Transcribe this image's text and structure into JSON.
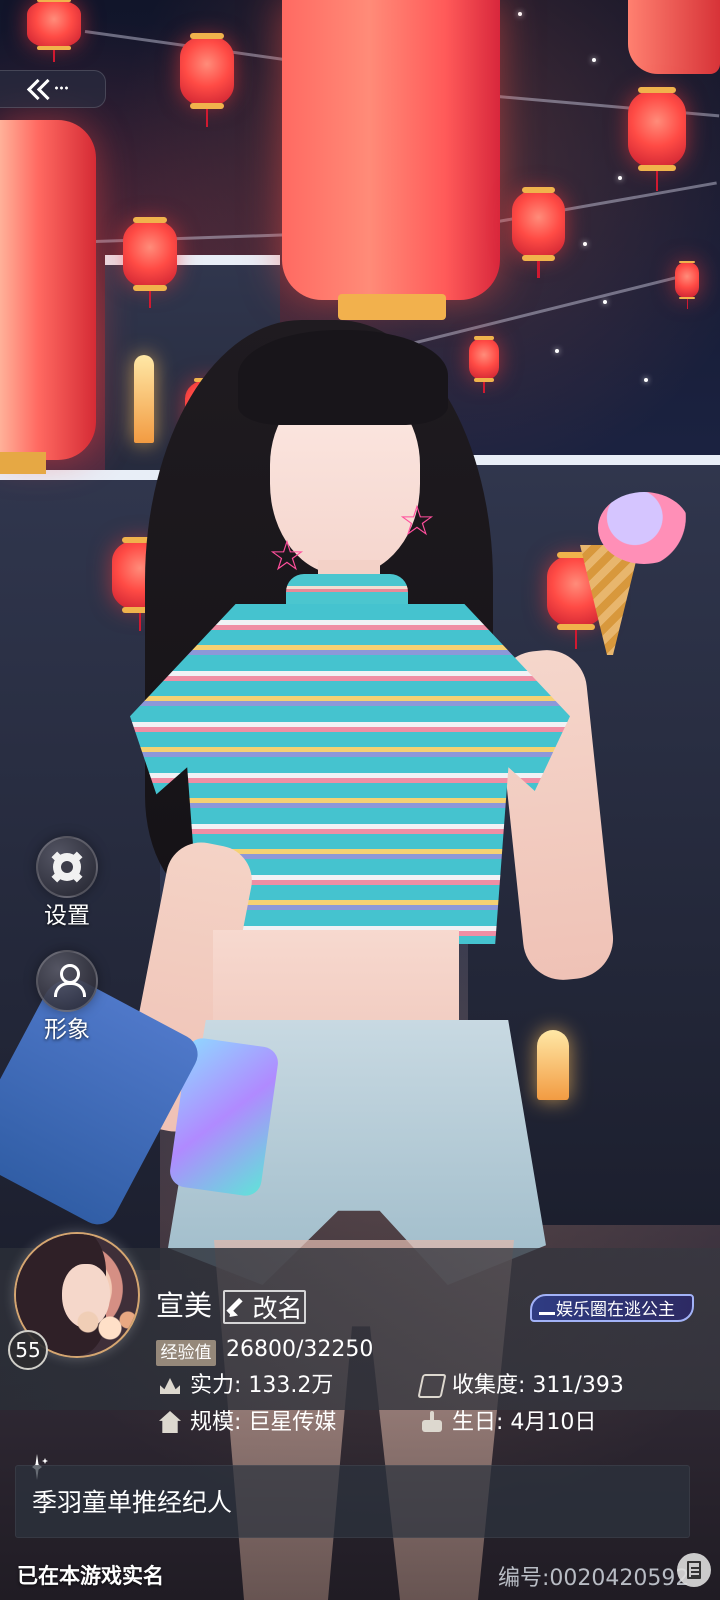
{
  "header": {
    "back_label": ""
  },
  "side_menu": {
    "settings_label": "设置",
    "appearance_label": "形象"
  },
  "profile": {
    "level": "55",
    "name": "宣美",
    "rename_label": "改名",
    "title_badge": "娱乐圈在逃公主",
    "exp_label": "经验值",
    "exp_value": "26800/32250",
    "strength_label": "实力:",
    "strength_value": "133.2万",
    "collection_label": "收集度:",
    "collection_value": "311/393",
    "scale_label": "规模:",
    "scale_value": "巨星传媒",
    "birthday_label": "生日:",
    "birthday_value": "4月10日",
    "signature": "季羽童单推经纪人"
  },
  "footer": {
    "verified_text": "已在本游戏实名",
    "player_id": "编号:0020420592"
  },
  "icons": {
    "back": "double-chevron-left-icon",
    "settings": "gear-icon",
    "appearance": "person-icon",
    "rename": "pencil-icon",
    "title": "crown-icon",
    "strength": "crown-icon",
    "collection": "book-icon",
    "scale": "building-icon",
    "birthday": "cake-icon",
    "signature": "sparkle-icon",
    "notes": "notes-icon"
  },
  "colors": {
    "panel_overlay": "#2a2e37",
    "title_badge": "#2f3c83",
    "exp_label_bg": "#95887a"
  }
}
